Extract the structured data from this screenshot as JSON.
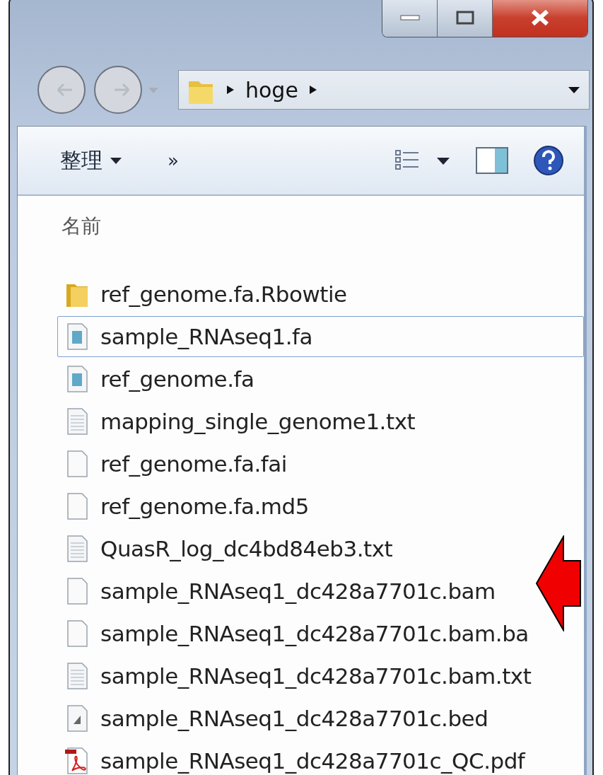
{
  "address_bar": {
    "path": [
      "hoge"
    ]
  },
  "toolbar": {
    "organize": "整理",
    "more": "»"
  },
  "column_header": "名前",
  "files": [
    {
      "name": "ref_genome.fa.Rbowtie",
      "kind": "folder",
      "selected": false
    },
    {
      "name": "sample_RNAseq1.fa",
      "kind": "fasta",
      "selected": true
    },
    {
      "name": "ref_genome.fa",
      "kind": "fasta",
      "selected": false
    },
    {
      "name": "mapping_single_genome1.txt",
      "kind": "text",
      "selected": false
    },
    {
      "name": "ref_genome.fa.fai",
      "kind": "blank",
      "selected": false
    },
    {
      "name": "ref_genome.fa.md5",
      "kind": "blank",
      "selected": false
    },
    {
      "name": "QuasR_log_dc4bd84eb3.txt",
      "kind": "text",
      "selected": false
    },
    {
      "name": "sample_RNAseq1_dc428a7701c.bam",
      "kind": "blank",
      "selected": false
    },
    {
      "name": "sample_RNAseq1_dc428a7701c.bam.ba",
      "kind": "blank",
      "selected": false
    },
    {
      "name": "sample_RNAseq1_dc428a7701c.bam.txt",
      "kind": "text",
      "selected": false
    },
    {
      "name": "sample_RNAseq1_dc428a7701c.bed",
      "kind": "bed",
      "selected": false
    },
    {
      "name": "sample_RNAseq1_dc428a7701c_QC.pdf",
      "kind": "pdf",
      "selected": false
    }
  ]
}
